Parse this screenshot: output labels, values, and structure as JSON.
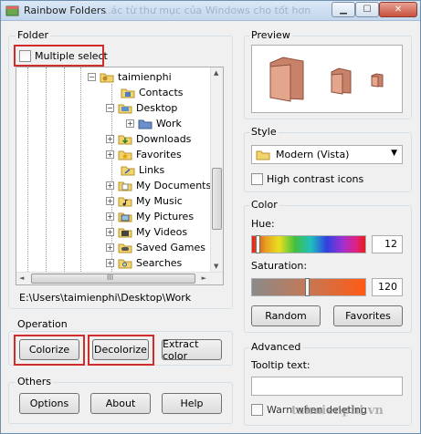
{
  "window": {
    "title": "Rainbow Folders",
    "ghost_title": "...ác từ thư mục của Windows cho tốt hơn"
  },
  "folder_group": {
    "label": "Folder",
    "multiple_select_label": "Multiple select",
    "multiple_select_checked": false,
    "path": "E:\\Users\\taimienphi\\Desktop\\Work"
  },
  "tree": {
    "items": [
      {
        "label": "taimienphi",
        "expander": "−",
        "icon": "user-folder"
      },
      {
        "label": "Contacts",
        "expander": "",
        "icon": "contacts-folder"
      },
      {
        "label": "Desktop",
        "expander": "−",
        "icon": "desktop-folder"
      },
      {
        "label": "Work",
        "expander": "+",
        "icon": "work-folder"
      },
      {
        "label": "Downloads",
        "expander": "+",
        "icon": "downloads-folder"
      },
      {
        "label": "Favorites",
        "expander": "+",
        "icon": "favorites-folder"
      },
      {
        "label": "Links",
        "expander": "",
        "icon": "links-folder"
      },
      {
        "label": "My Documents",
        "expander": "+",
        "icon": "documents-folder"
      },
      {
        "label": "My Music",
        "expander": "+",
        "icon": "music-folder"
      },
      {
        "label": "My Pictures",
        "expander": "+",
        "icon": "pictures-folder"
      },
      {
        "label": "My Videos",
        "expander": "+",
        "icon": "videos-folder"
      },
      {
        "label": "Saved Games",
        "expander": "+",
        "icon": "games-folder"
      },
      {
        "label": "Searches",
        "expander": "+",
        "icon": "search-folder"
      }
    ],
    "scroll_left_symbol": "◄",
    "scroll_right_symbol": "►",
    "scroll_up_symbol": "▲",
    "scroll_down_symbol": "▼",
    "hscroll_grip": "III"
  },
  "operation_group": {
    "label": "Operation",
    "colorize": "Colorize",
    "decolorize": "Decolorize",
    "extract_color": "Extract color"
  },
  "others_group": {
    "label": "Others",
    "options": "Options",
    "about": "About",
    "help": "Help"
  },
  "preview_group": {
    "label": "Preview"
  },
  "style_group": {
    "label": "Style",
    "selected_style": "Modern (Vista)",
    "high_contrast_label": "High contrast icons",
    "high_contrast_checked": false
  },
  "color_group": {
    "label": "Color",
    "hue_label": "Hue:",
    "hue_value": "12",
    "saturation_label": "Saturation:",
    "saturation_value": "120",
    "random": "Random",
    "favorites": "Favorites"
  },
  "advanced_group": {
    "label": "Advanced",
    "tooltip_label": "Tooltip text:",
    "tooltip_value": "",
    "warn_label": "Warn when deleting",
    "warn_checked": false
  },
  "watermark": "taimienphi.vn",
  "colors": {
    "folder_tint": "#d9957a",
    "highlight_red": "#d22b2b",
    "saturation_end": "#ff5a14"
  }
}
